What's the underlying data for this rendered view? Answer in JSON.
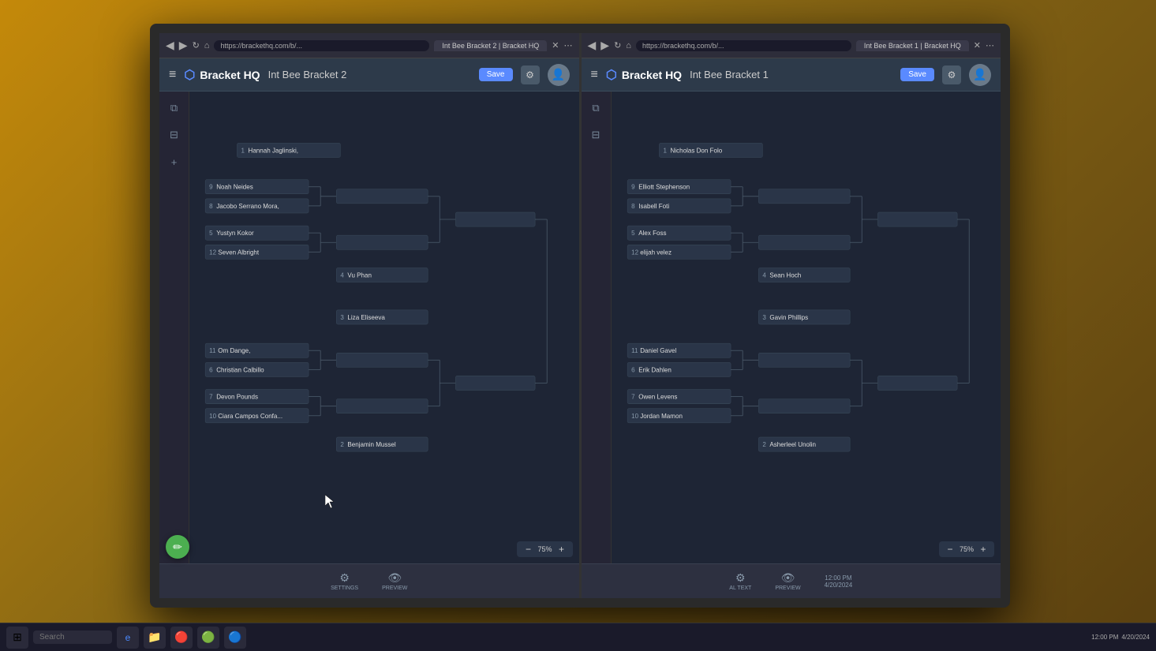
{
  "room": {
    "background": "classroom with yellow/orange walls"
  },
  "monitor_left": {
    "browser": {
      "tab": "Int Bee Bracket 2 | Bracket HQ",
      "url": "https://brackethq.com/b/..."
    },
    "app": {
      "logo": "Bracket HQ",
      "title": "Int Bee Bracket 2",
      "save_button": "Save"
    },
    "bracket": {
      "participants": [
        {
          "seed": "1",
          "name": "Hannah Jaglinski,"
        },
        {
          "seed": "9",
          "name": "Noah Neides"
        },
        {
          "seed": "8",
          "name": "Jacobo Serrano Mora,"
        },
        {
          "seed": "5",
          "name": "Yustyn Kokor"
        },
        {
          "seed": "12",
          "name": "Seven Albright"
        },
        {
          "seed": "4",
          "name": "Vu Phan"
        },
        {
          "seed": "3",
          "name": "Liza Eliseeva"
        },
        {
          "seed": "11",
          "name": "Om Dange,"
        },
        {
          "seed": "6",
          "name": "Christian Calbillo"
        },
        {
          "seed": "7",
          "name": "Devon Pounds"
        },
        {
          "seed": "10",
          "name": "Ciara Campos Confa de Asca,"
        },
        {
          "seed": "2",
          "name": "Benjamin Mussel"
        }
      ],
      "zoom": "75%"
    },
    "toolbar": {
      "settings_label": "SETTINGS",
      "preview_label": "PREVIEW"
    }
  },
  "monitor_right": {
    "browser": {
      "tab": "Int Bee Bracket 1 | Bracket HQ",
      "url": "https://brackethq.com/b/..."
    },
    "app": {
      "logo": "Bracket HQ",
      "title": "Int Bee Bracket 1",
      "save_button": "Save"
    },
    "bracket": {
      "participants": [
        {
          "seed": "1",
          "name": "Nicholas Don Folo"
        },
        {
          "seed": "9",
          "name": "Elliott Stephenson"
        },
        {
          "seed": "8",
          "name": "Isabell Foti"
        },
        {
          "seed": "5",
          "name": "Alex Foss"
        },
        {
          "seed": "12",
          "name": "elijah velez"
        },
        {
          "seed": "4",
          "name": "Sean Hoch"
        },
        {
          "seed": "3",
          "name": "Gavin Phillips"
        },
        {
          "seed": "11",
          "name": "Daniel Gavel"
        },
        {
          "seed": "6",
          "name": "Erik Dahlen"
        },
        {
          "seed": "7",
          "name": "Owen Levens"
        },
        {
          "seed": "10",
          "name": "Jordan Mamon"
        },
        {
          "seed": "2",
          "name": "Asherleel Unolin"
        }
      ],
      "zoom": "75%"
    },
    "toolbar": {
      "preview_label": "PREVIEW",
      "al_text": "AL TEXT"
    }
  },
  "taskbar": {
    "search_placeholder": "Search",
    "time": "12:00 PM",
    "date": "4/20/2024"
  },
  "icons": {
    "hamburger": "≡",
    "gear": "⚙",
    "user": "👤",
    "settings": "⚙",
    "preview": "👁",
    "plus": "+",
    "minus": "−",
    "pencil": "✏"
  }
}
